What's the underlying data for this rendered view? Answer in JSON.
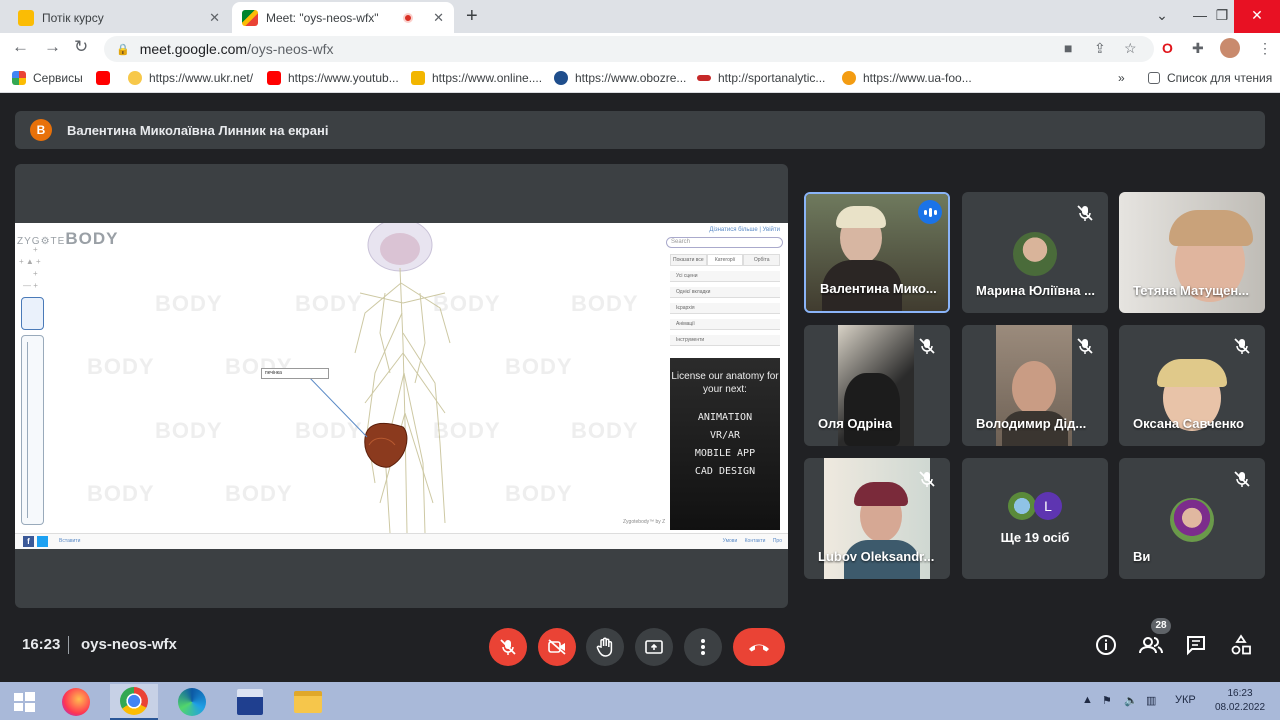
{
  "browser": {
    "tabs": [
      {
        "title": "Потік курсу"
      },
      {
        "title": "Meet: \"oys-neos-wfx\""
      }
    ],
    "url_host": "meet.google.com",
    "url_path": "/oys-neos-wfx",
    "bookmarks": [
      {
        "label": "Сервисы"
      },
      {
        "label": ""
      },
      {
        "label": "https://www.ukr.net/"
      },
      {
        "label": "https://www.youtub..."
      },
      {
        "label": "https://www.online...."
      },
      {
        "label": "https://www.obozre..."
      },
      {
        "label": "http://sportanalytic..."
      },
      {
        "label": "https://www.ua-foo..."
      }
    ],
    "reading_list": "Список для чтения",
    "more": "»"
  },
  "meet": {
    "presenter_banner": {
      "avatar_letter": "В",
      "text": "Валентина Миколаївна Линник на екрані"
    },
    "shared_screen": {
      "logo_prefix": "ZYG",
      "logo_mid": "TE",
      "logo_main": "BODY",
      "watermark": "BODY",
      "top_links": "Дізнатися більше  |  Увійти",
      "search_placeholder": "Search",
      "tabs": [
        "Показати все",
        "Категорії",
        "Орбіта"
      ],
      "rows": [
        "Усі сцени",
        "Однієї вкладки",
        "Ієрархія",
        "Анімації",
        "Інструменти"
      ],
      "label_pin": "печінка",
      "ad_head": "License our anatomy for your next:",
      "ad_items": [
        "ANIMATION",
        "VR/AR",
        "MOBILE APP",
        "CAD DESIGN"
      ],
      "footer_left": "Вставити",
      "footer_right": "Умови  Контакти  Про",
      "credit": "Zygotebody™ by Z"
    },
    "participants": [
      {
        "name": "Валентина Мико..."
      },
      {
        "name": "Марина Юліївна ..."
      },
      {
        "name": "Тетяна Матущен..."
      },
      {
        "name": "Оля Одріна"
      },
      {
        "name": "Володимир Дід..."
      },
      {
        "name": "Оксана Савченко"
      },
      {
        "name": "Lubov Oleksandr..."
      },
      {
        "name": "Ще 19 осіб",
        "avatar_letter": "L"
      },
      {
        "name": "Ви"
      }
    ],
    "time": "16:23",
    "meeting_code": "oys-neos-wfx",
    "people_count": "28"
  },
  "taskbar": {
    "lang": "УКР",
    "time": "16:23",
    "date": "08.02.2022"
  },
  "colors": {
    "meet_bg": "#202124",
    "tile_bg": "#3c4043",
    "red": "#ea4335",
    "accent_blue": "#1a73e8"
  }
}
